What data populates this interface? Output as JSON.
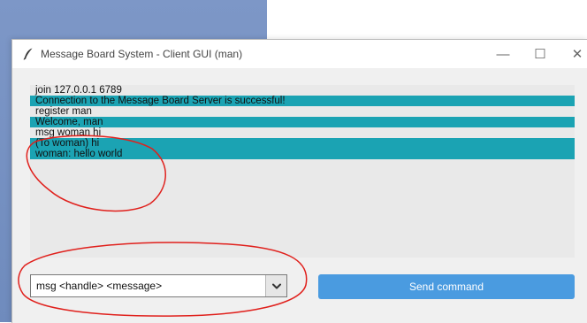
{
  "window": {
    "title": "Message Board System - Client GUI (man)",
    "app_icon": "feather-icon",
    "controls": {
      "minimize": "—",
      "maximize": "☐",
      "close": "✕"
    }
  },
  "log": {
    "lines": [
      {
        "text": "join 127.0.0.1 6789",
        "kind": "command"
      },
      {
        "text": "Connection to the Message Board Server is successful!",
        "kind": "response"
      },
      {
        "text": "register man",
        "kind": "command"
      },
      {
        "text": "Welcome, man",
        "kind": "response"
      },
      {
        "text": "msg woman hi",
        "kind": "command"
      },
      {
        "text": "(To woman) hi",
        "kind": "response"
      },
      {
        "text": "woman: hello world",
        "kind": "response"
      }
    ]
  },
  "command": {
    "value": "msg <handle> <message>",
    "dropdown_icon": "chevron-down-icon"
  },
  "send_button": {
    "label": "Send command"
  },
  "colors": {
    "response_highlight": "#1ba3b3",
    "send_button": "#4a9be0",
    "annotation": "#e0201c",
    "desktop": "#7d97c7"
  }
}
